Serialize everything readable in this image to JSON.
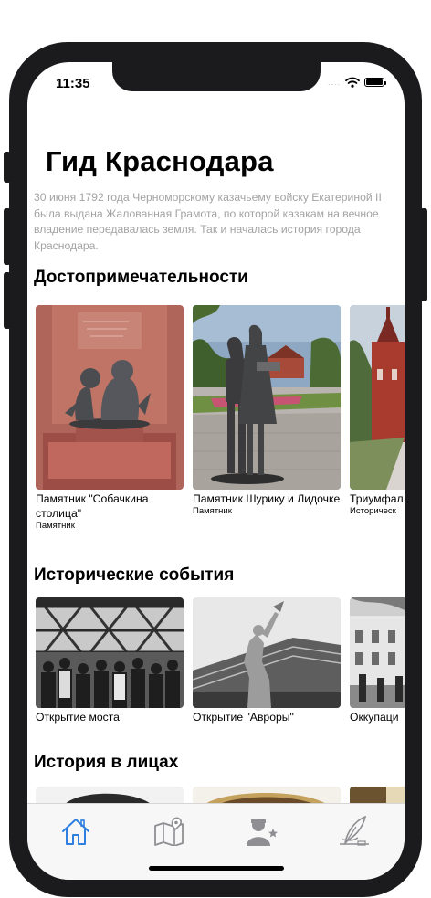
{
  "status": {
    "time": "11:35",
    "dots": "....",
    "battery_level": 1.0
  },
  "page": {
    "title": "Гид Краснодара",
    "intro": "30 июня 1792 года Черноморскому казачьему войску Екатериной II была выдана Жалованная Грамота, по которой казакам на вечное владение передавалась земля. Так и началась история города Краснодара."
  },
  "sections": {
    "sights": {
      "title": "Достопримечательности",
      "items": [
        {
          "name": "Памятник \"Собачкина столица\"",
          "type": "Памятник"
        },
        {
          "name": "Памятник Шурику и Лидочке",
          "type": "Памятник"
        },
        {
          "name": "Триумфал",
          "type": "Историческ"
        }
      ]
    },
    "events": {
      "title": "Исторические события",
      "items": [
        {
          "name": "Открытие моста"
        },
        {
          "name": "Открытие \"Авроры\""
        },
        {
          "name": "Оккупаци"
        }
      ]
    },
    "people": {
      "title": "История в лицах"
    }
  },
  "tabbar": {
    "active_color": "#2f7fe0",
    "inactive_color": "#8e8e93",
    "tabs": [
      {
        "icon": "home-icon",
        "active": true
      },
      {
        "icon": "map-icon",
        "active": false
      },
      {
        "icon": "person-star-icon",
        "active": false
      },
      {
        "icon": "quill-icon",
        "active": false
      }
    ]
  }
}
